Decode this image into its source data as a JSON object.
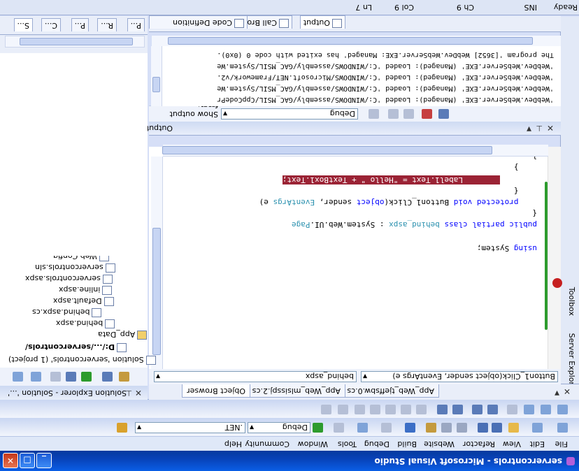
{
  "window": {
    "title": "servercontrols - Microsoft Visual Studio"
  },
  "menu": [
    "File",
    "Edit",
    "View",
    "Refactor",
    "Website",
    "Build",
    "Debug",
    "Tools",
    "Window",
    "Community",
    "Help"
  ],
  "toolbar": {
    "config": "Debug",
    "platform": ".NET"
  },
  "document_tabs": [
    {
      "label": "App_Web_tjeffsbw.0.cs",
      "active": false
    },
    {
      "label": "App_Web_mlsisspj.2.cs",
      "active": false
    },
    {
      "label": "Object Browser",
      "active": false
    }
  ],
  "navbar": {
    "left": "behind_aspx",
    "right": "Button1_Click(object sender, EventArgs e)"
  },
  "code": [
    "using System;",
    "",
    "public partial class behind_aspx : System.Web.UI.Page",
    "{",
    "    protected void Button1_Click(object sender, EventArgs e)",
    "    {",
    "        Label1.Text = \"Hello \" + TextBox1.Text;",
    "    }",
    "}"
  ],
  "output": {
    "title": "Output",
    "show_from_label": "Show output from:",
    "show_from_value": "Debug",
    "lines": [
      "'WebDev.WebServer.EXE' (Managed): Loaded 'C:/WINDOWS/assembly/GAC_MSIL/CppCodePr",
      "'WebDev.WebServer.EXE' (Managed): Loaded 'C:/WINDOWS/assembly/GAC_MSIL/System.We",
      "'WebDev.WebServer.EXE' (Managed): Loaded 'C:/WINDOWS/Microsoft.NET/Framework/v2.",
      "'WebDev.WebServer.EXE' (Managed): Loaded 'C:/WINDOWS/assembly/GAC_MSIL/System.We",
      "The program '[3652] WebDev.WebServer.EXE: Managed' has exited with code 0 (0x0)."
    ]
  },
  "bottom_tabs": [
    "Output",
    "Call Browser",
    "Code Definition Window"
  ],
  "side_tabs": [
    "Server Explorer",
    "Toolbox"
  ],
  "solution_explorer": {
    "title": "Solution Explorer - Solution '...'",
    "solution": "Solution 'servercontrols' (1 project)",
    "project": "D:/.../servercontrols/",
    "items": [
      "App_Data",
      "behind.aspx",
      "behind.aspx.cs",
      "Default.aspx",
      "inline.aspx",
      "servercontrols.aspx",
      "servercontrols.sln",
      "Web.Config"
    ]
  },
  "right_tabs": [
    "S...",
    "C...",
    "P...",
    "R...",
    "P..."
  ],
  "status": {
    "ready": "Ready",
    "ln": "Ln 7",
    "col": "Col 9",
    "ch": "Ch 9",
    "mode": "INS"
  }
}
